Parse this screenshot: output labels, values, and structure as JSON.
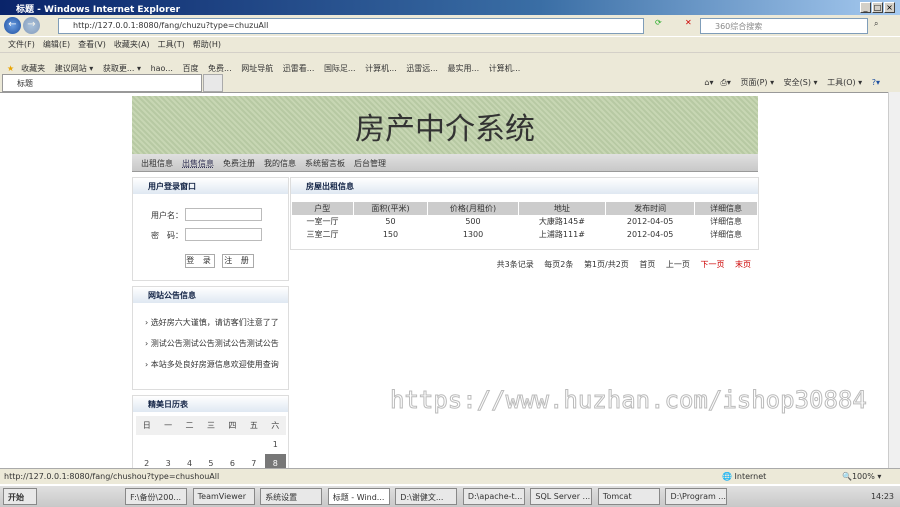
{
  "browser": {
    "title": "标题 - Windows Internet Explorer",
    "url": "http://127.0.0.1:8080/fang/chuzu?type=chuzuAll",
    "search_placeholder": "360综合搜索",
    "menu": [
      "文件(F)",
      "编辑(E)",
      "查看(V)",
      "收藏夹(A)",
      "工具(T)",
      "帮助(H)"
    ],
    "favorites": [
      "收藏夹",
      "建议网站 ▾",
      "获取更... ▾",
      "hao...",
      "百度",
      "免费...",
      "网址导航",
      "迅雷看...",
      "国际足...",
      "计算机...",
      "迅雷远...",
      "最实用...",
      "计算机..."
    ],
    "tab_title": "标题",
    "commands": [
      "页面(P) ▾",
      "安全(S) ▾",
      "工具(O) ▾"
    ],
    "status_url": "http://127.0.0.1:8080/fang/chushou?type=chushouAll",
    "zone": "Internet",
    "zoom": "100%"
  },
  "site": {
    "banner_title": "房产中介系统",
    "nav": [
      "出租信息",
      "出售信息",
      "免费注册",
      "我的信息",
      "系统留言板",
      "后台管理"
    ],
    "login": {
      "title": "用户登录窗口",
      "username_label": "用户名：",
      "password_label": "密　码：",
      "login_button": "登 录",
      "register_button": "注 册"
    },
    "notice": {
      "title": "网站公告信息",
      "items": [
        "选好房六大谨慎，请访客们注意了了",
        "测试公告测试公告测试公告测试公告",
        "本站多处良好房源信息欢迎使用查询"
      ]
    },
    "calendar": {
      "title": "精美日历表",
      "weekdays": [
        "日",
        "一",
        "二",
        "三",
        "四",
        "五",
        "六"
      ],
      "row1": [
        "",
        "",
        "",
        "",
        "",
        "",
        "1"
      ],
      "row2": [
        "2",
        "3",
        "4",
        "5",
        "6",
        "7",
        "8"
      ],
      "today": "8"
    },
    "listing": {
      "title": "房屋出租信息",
      "columns": [
        "户型",
        "面积(平米)",
        "价格(月租价)",
        "地址",
        "发布时间",
        "详细信息"
      ],
      "rows": [
        [
          "一室一厅",
          "50",
          "500",
          "大康路145#",
          "2012-04-05",
          "详细信息"
        ],
        [
          "三室二厅",
          "150",
          "1300",
          "上浦路111#",
          "2012-04-05",
          "详细信息"
        ]
      ]
    },
    "pager": {
      "total": "共3条记录",
      "per_page": "每页2条",
      "page": "第1页/共2页",
      "first": "首页",
      "prev": "上一页",
      "next": "下一页",
      "last": "末页"
    }
  },
  "watermark": "https://www.huzhan.com/ishop30884",
  "taskbar": {
    "start": "开始",
    "tasks": [
      "F:\\备份\\200...",
      "TeamViewer",
      "系统设置",
      "标题 - Wind...",
      "D:\\谢健文...",
      "D:\\apache-t...",
      "SQL Server ...",
      "Tomcat",
      "D:\\Program ..."
    ],
    "clock": "14:23"
  }
}
